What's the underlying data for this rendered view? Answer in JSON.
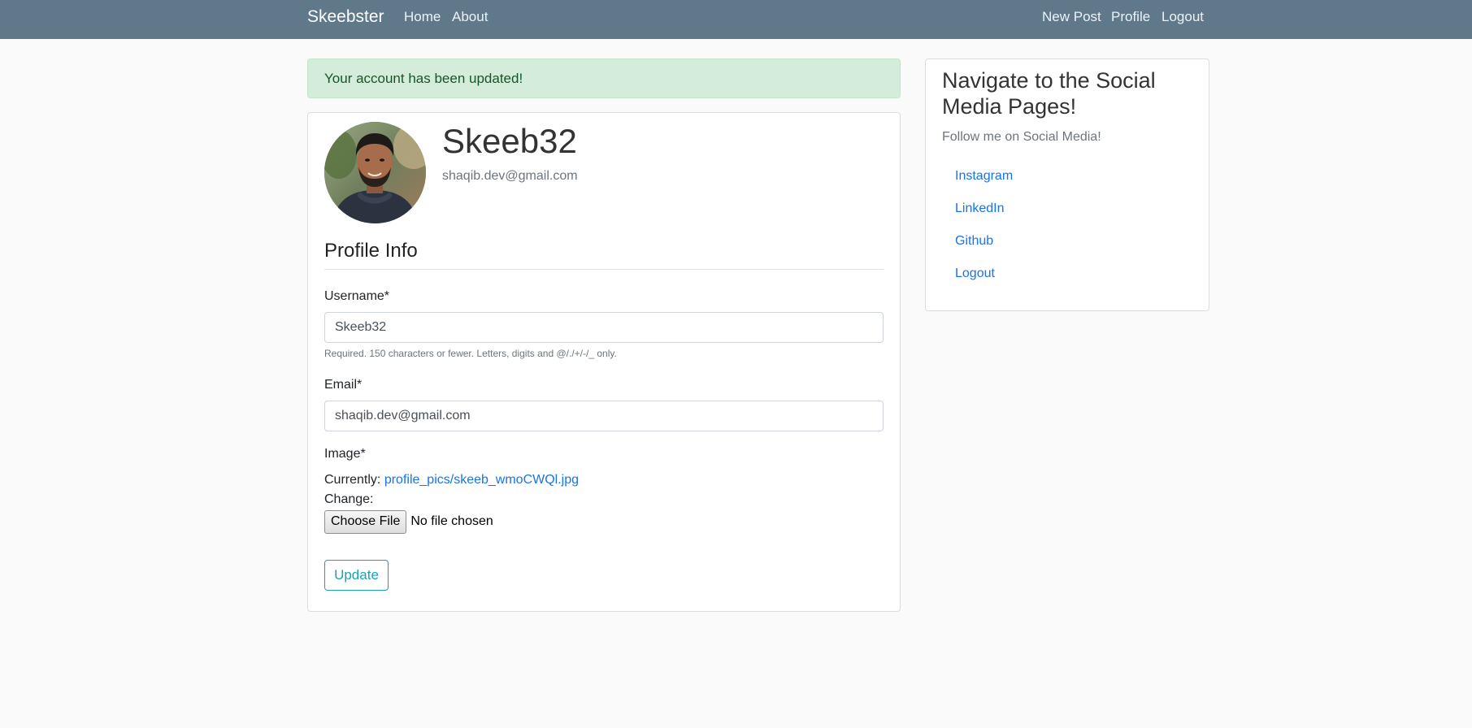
{
  "navbar": {
    "brand": "Skeebster",
    "left_links": [
      "Home",
      "About"
    ],
    "right_links": [
      "New Post",
      "Profile",
      "Logout"
    ]
  },
  "alert": {
    "message": "Your account has been updated!"
  },
  "profile": {
    "username": "Skeeb32",
    "email": "shaqib.dev@gmail.com"
  },
  "form": {
    "section_title": "Profile Info",
    "username_label": "Username*",
    "username_value": "Skeeb32",
    "username_help": "Required. 150 characters or fewer. Letters, digits and @/./+/-/_ only.",
    "email_label": "Email*",
    "email_value": "shaqib.dev@gmail.com",
    "image_label": "Image*",
    "currently_label": "Currently:",
    "currently_file": "profile_pics/skeeb_wmoCWQl.jpg",
    "change_label": "Change:",
    "choose_file_label": "Choose File",
    "no_file_text": "No file chosen",
    "update_label": "Update"
  },
  "sidebar": {
    "title": "Navigate to the Social Media Pages!",
    "subtitle": "Follow me on Social Media!",
    "links": [
      "Instagram",
      "LinkedIn",
      "Github",
      "Logout"
    ]
  },
  "colors": {
    "navbar_bg": "#5f788a",
    "alert_bg": "#d4edda",
    "alert_text": "#155724",
    "link": "#1a73e8",
    "update_button": "#17a2b8"
  }
}
